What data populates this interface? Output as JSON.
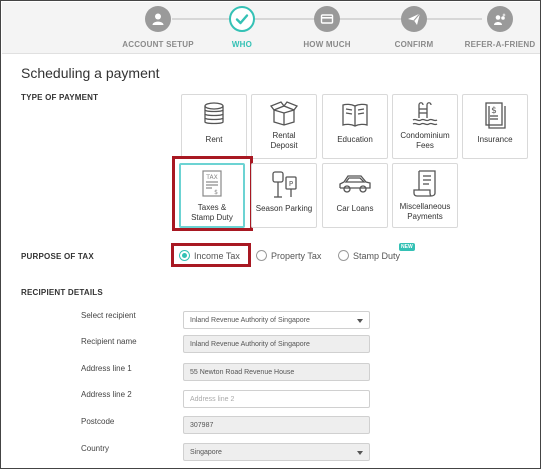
{
  "stepper": {
    "steps": [
      {
        "label": "ACCOUNT SETUP",
        "icon": "user-icon"
      },
      {
        "label": "WHO",
        "icon": "check-icon"
      },
      {
        "label": "HOW MUCH",
        "icon": "card-icon"
      },
      {
        "label": "CONFIRM",
        "icon": "paper-plane-icon"
      },
      {
        "label": "REFER-A-FRIEND",
        "icon": "users-sparkle-icon"
      }
    ],
    "active_step": "WHO",
    "accent_color": "#34c1b5"
  },
  "page_title": "Scheduling a payment",
  "type_of_payment": {
    "label": "TYPE OF PAYMENT",
    "tiles": [
      {
        "label": "Rent",
        "icon": "coins-icon"
      },
      {
        "label": "Rental Deposit",
        "icon": "box-icon"
      },
      {
        "label": "Education",
        "icon": "book-icon"
      },
      {
        "label": "Condominium Fees",
        "icon": "pool-icon"
      },
      {
        "label": "Insurance",
        "icon": "document-dollar-icon"
      },
      {
        "label": "Taxes & Stamp Duty",
        "icon": "tax-form-icon"
      },
      {
        "label": "Season Parking",
        "icon": "parking-meter-icon"
      },
      {
        "label": "Car Loans",
        "icon": "car-icon"
      },
      {
        "label": "Miscellaneous Payments",
        "icon": "receipt-icon"
      }
    ],
    "selected": "Taxes & Stamp Duty"
  },
  "purpose_of_tax": {
    "label": "PURPOSE OF TAX",
    "options": [
      "Income Tax",
      "Property Tax",
      "Stamp Duty"
    ],
    "selected": "Income Tax",
    "new_badge": "NEW"
  },
  "recipient_details": {
    "label": "RECIPIENT DETAILS",
    "select_recipient": {
      "label": "Select recipient",
      "value": "Inland Revenue Authority of Singapore"
    },
    "recipient_name": {
      "label": "Recipient name",
      "value": "Inland Revenue Authority of Singapore"
    },
    "address_line_1": {
      "label": "Address line 1",
      "value": "55 Newton Road Revenue House"
    },
    "address_line_2": {
      "label": "Address line 2",
      "placeholder": "Address line 2"
    },
    "postcode": {
      "label": "Postcode",
      "value": "307987"
    },
    "country": {
      "label": "Country",
      "value": "Singapore"
    }
  },
  "highlight_color": "#a81822"
}
